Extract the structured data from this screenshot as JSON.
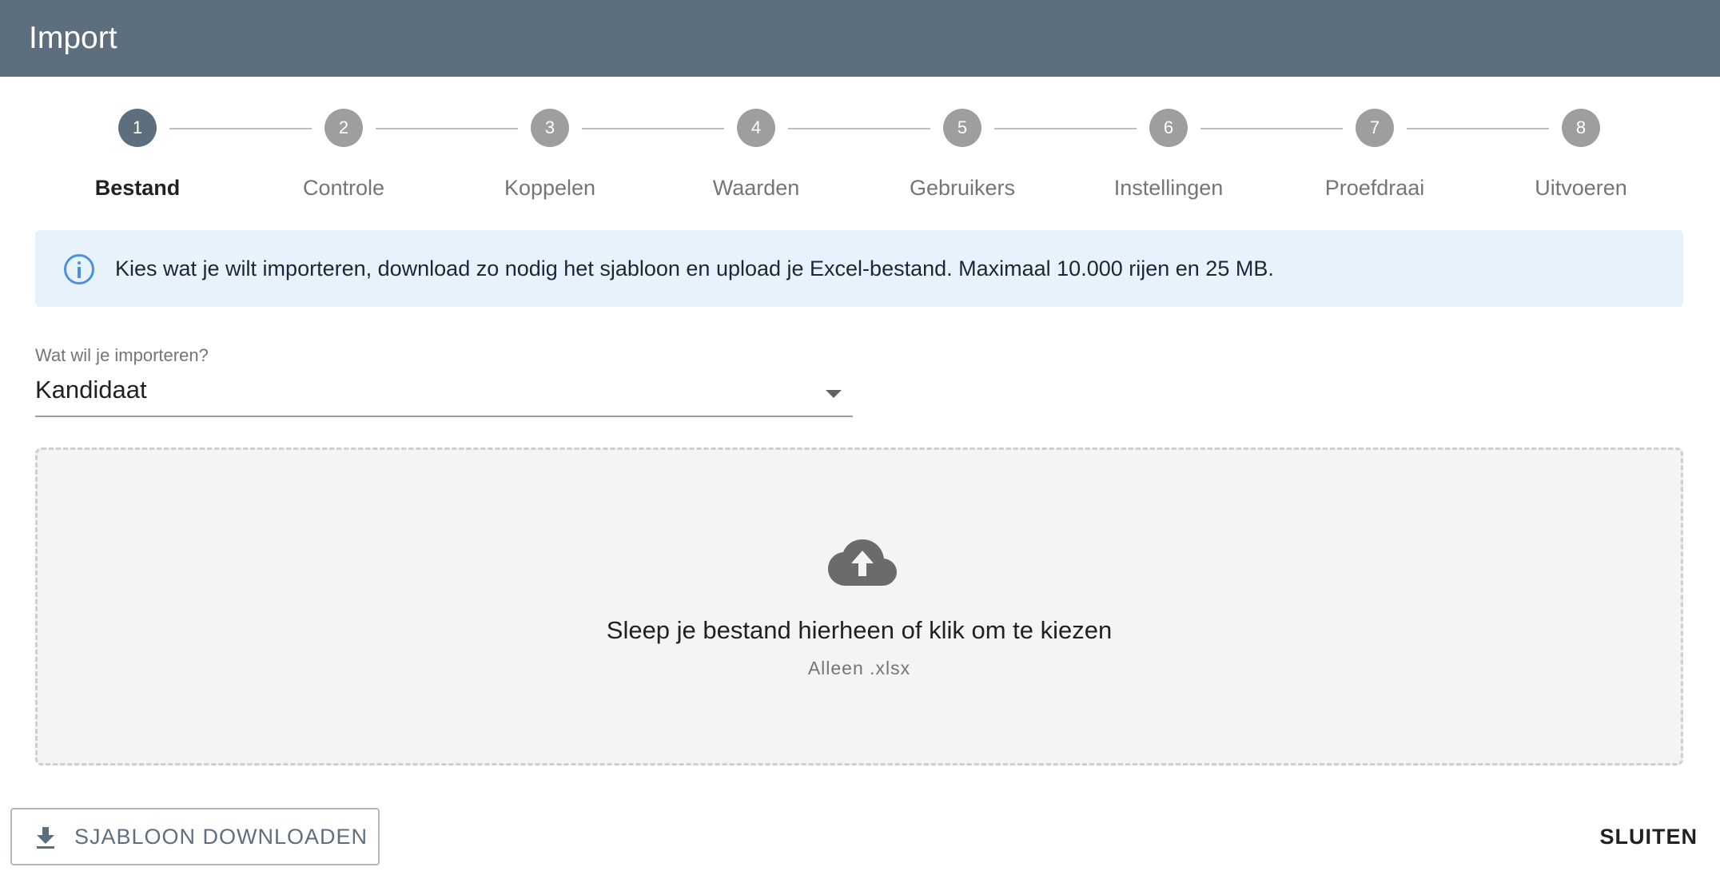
{
  "colors": {
    "header_bg": "#5d6f7e",
    "accent": "#5d6f7e",
    "info_bg": "#e8f2fc",
    "info_icon": "#4a8fe0"
  },
  "header": {
    "title": "Import"
  },
  "stepper": {
    "active_step": 1,
    "steps": [
      {
        "number": "1",
        "label": "Bestand"
      },
      {
        "number": "2",
        "label": "Controle"
      },
      {
        "number": "3",
        "label": "Koppelen"
      },
      {
        "number": "4",
        "label": "Waarden"
      },
      {
        "number": "5",
        "label": "Gebruikers"
      },
      {
        "number": "6",
        "label": "Instellingen"
      },
      {
        "number": "7",
        "label": "Proefdraai"
      },
      {
        "number": "8",
        "label": "Uitvoeren"
      }
    ]
  },
  "info": {
    "icon": "info-icon",
    "text": "Kies wat je wilt importeren, download zo nodig het sjabloon en upload je Excel-bestand. Maximaal 10.000 rijen en 25 MB."
  },
  "type_select": {
    "label": "Wat wil je importeren?",
    "value": "Kandidaat",
    "icon": "chevron-down-icon"
  },
  "dropzone": {
    "icon": "cloud-upload-icon",
    "title": "Sleep je bestand hierheen of klik om te kiezen",
    "subtitle": "Alleen .xlsx"
  },
  "actions": {
    "download_label": "SJABLOON DOWNLOADEN",
    "download_icon": "download-icon",
    "close_label": "SLUITEN"
  }
}
